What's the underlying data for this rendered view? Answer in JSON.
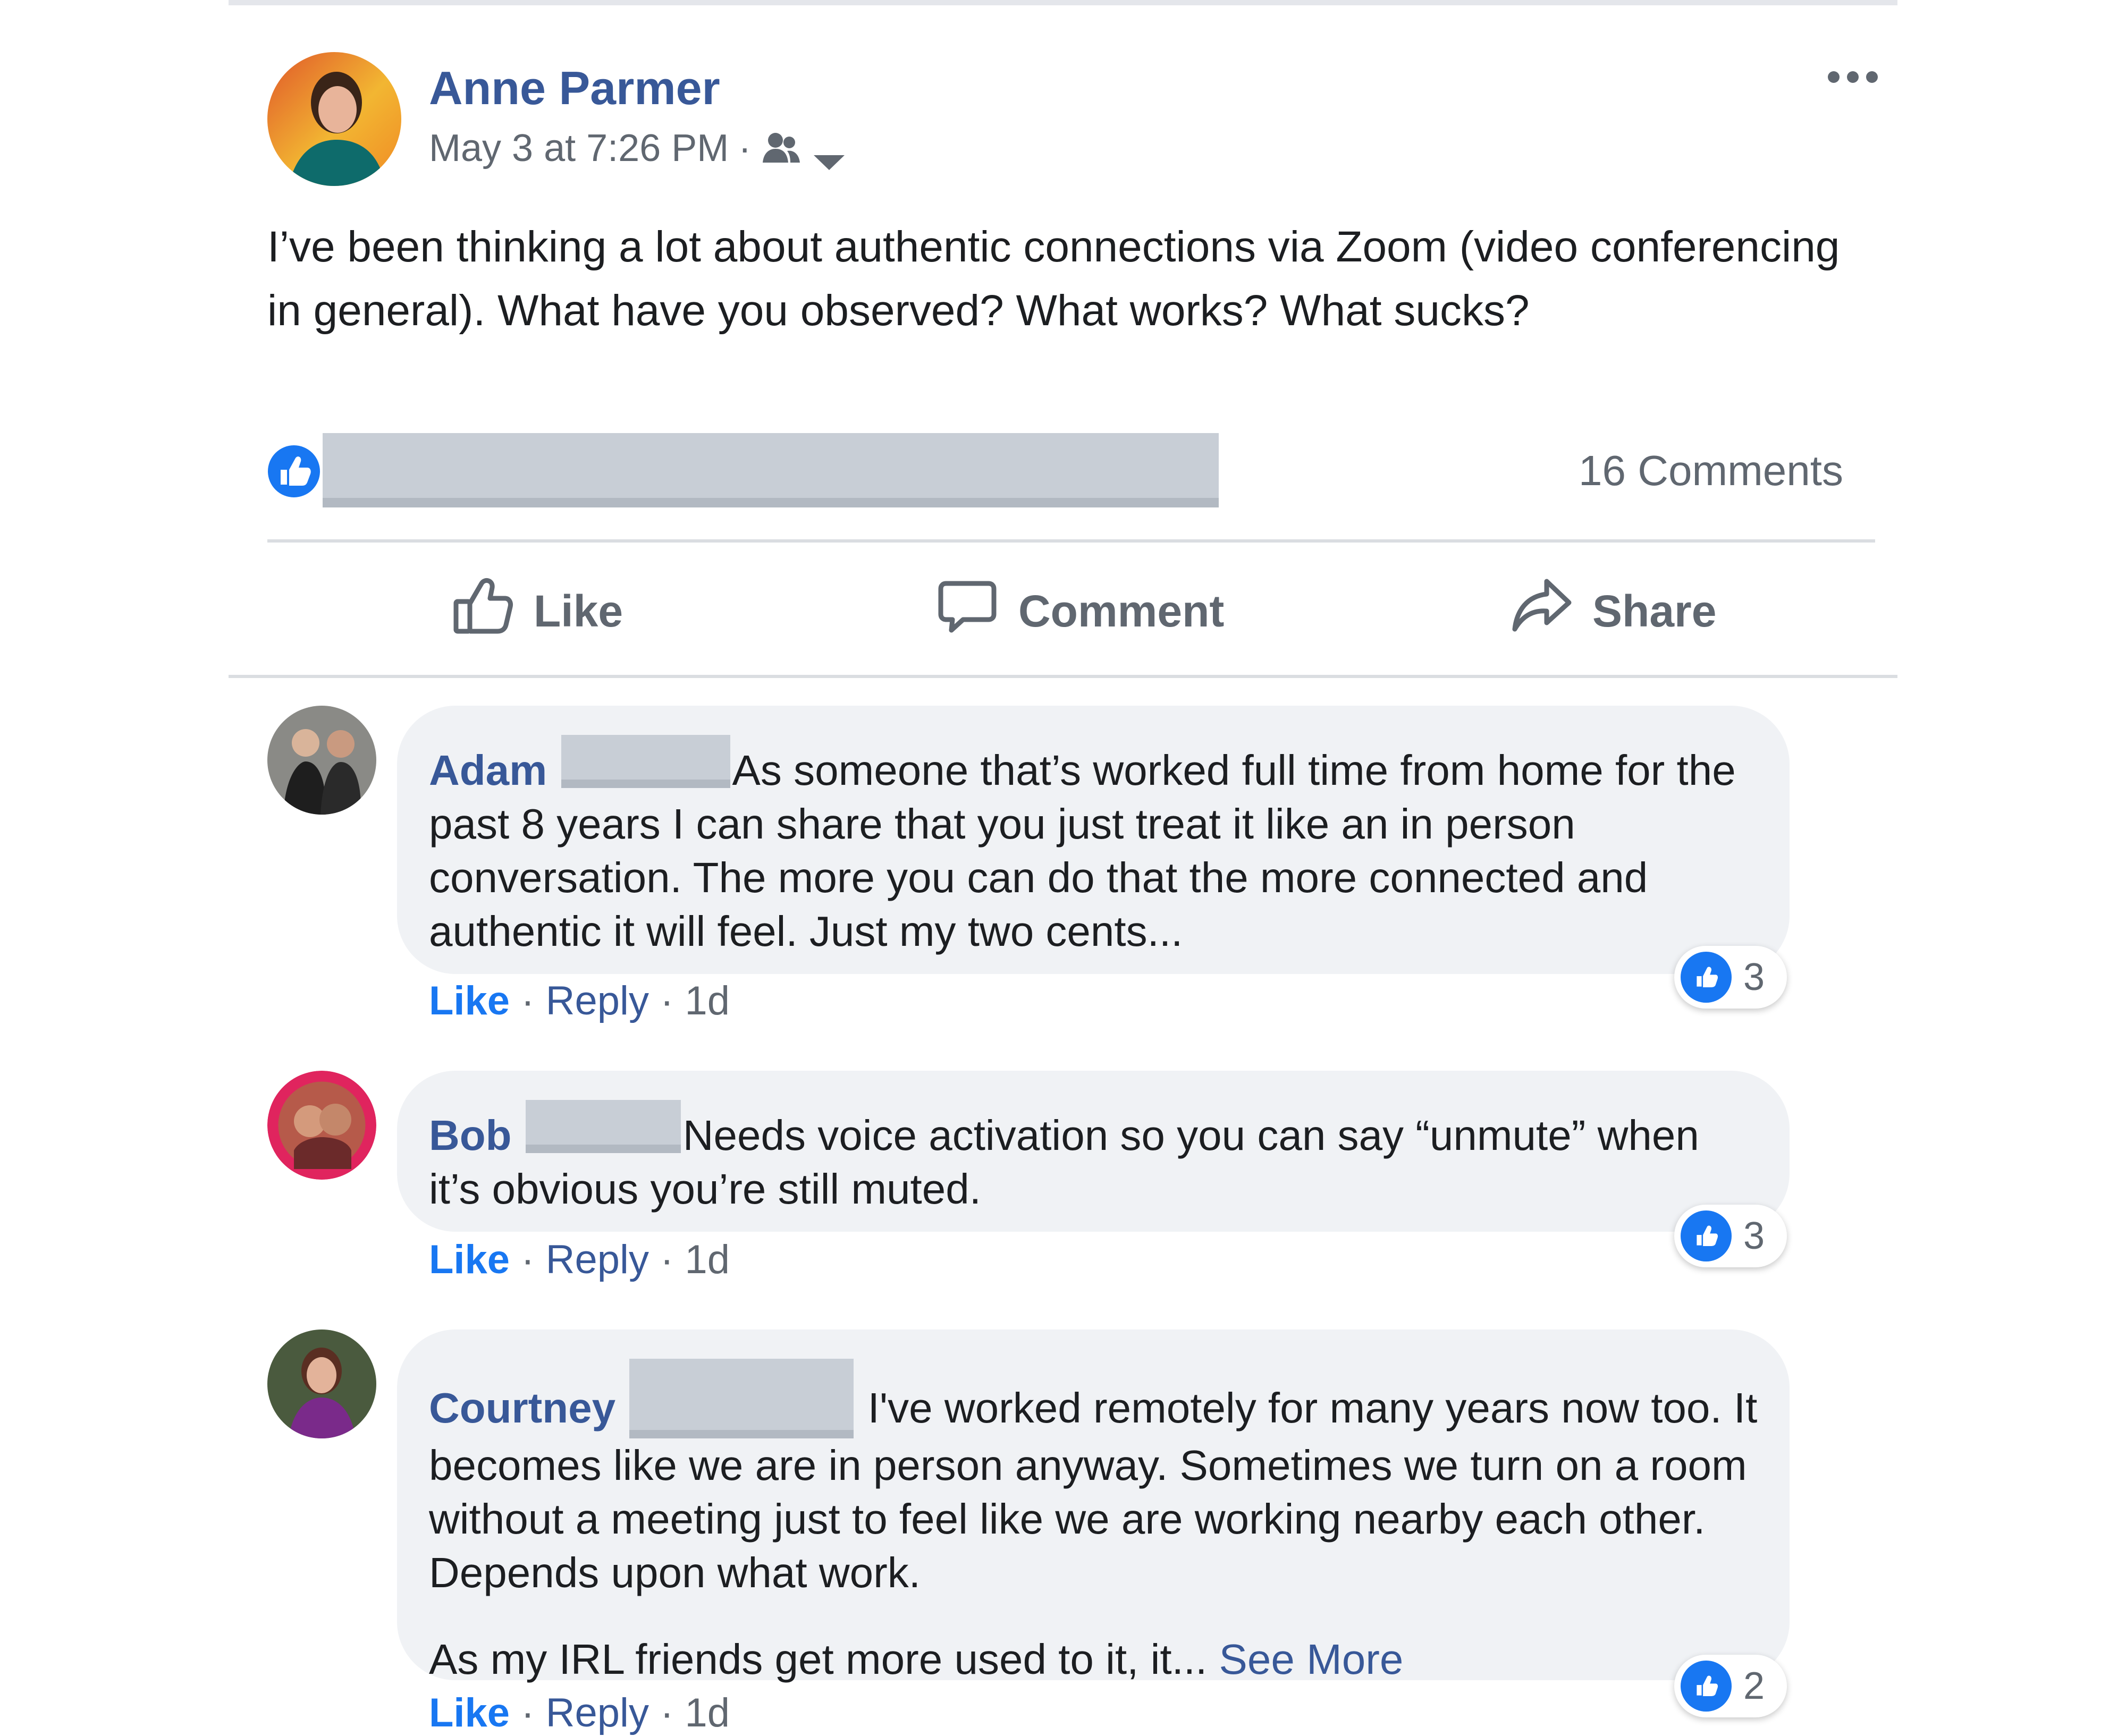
{
  "post": {
    "author": "Anne Parmer",
    "timestamp": "May 3 at 7:26 PM",
    "separator": "·",
    "audience_icon": "friends-icon",
    "text": "I’ve been thinking a lot about authentic connections via Zoom (video conferencing in general). What have you observed? What works? What sucks?",
    "comments_count": "16 Comments"
  },
  "actions": {
    "like_label": "Like",
    "comment_label": "Comment",
    "share_label": "Share"
  },
  "comments": [
    {
      "name": "Adam",
      "text": "As someone that’s worked full time from home for the past 8 years I can share that you just treat it like an in person conversation. The more you can do that the more connected and authentic it will feel. Just my two cents...",
      "like": "Like",
      "reply": "Reply",
      "age": "1d",
      "reactions": "3"
    },
    {
      "name": "Bob",
      "text": "Needs voice activation so you can say “unmute” when it’s obvious you’re still muted.",
      "like": "Like",
      "reply": "Reply",
      "age": "1d",
      "reactions": "3"
    },
    {
      "name": "Courtney",
      "text": "I've worked remotely for many years now too. It becomes like we are in person anyway. Sometimes we turn on a room without a meeting just to feel like we are working nearby each other. Depends upon what work.",
      "text2": "As my IRL friends get more used to it, it...",
      "see_more": "See More",
      "like": "Like",
      "reply": "Reply",
      "age": "1d",
      "reactions": "2"
    }
  ],
  "colors": {
    "name_link": "#385898",
    "like_blue": "#1877f2",
    "meta_gray": "#606770",
    "bubble_bg": "#f0f2f5"
  }
}
